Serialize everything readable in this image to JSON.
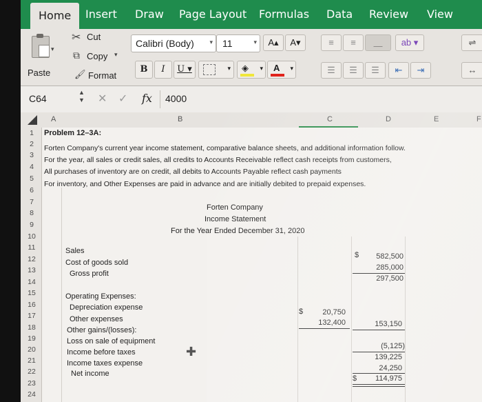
{
  "ribbon_tabs": [
    "Home",
    "Insert",
    "Draw",
    "Page Layout",
    "Formulas",
    "Data",
    "Review",
    "View"
  ],
  "clipboard": {
    "paste": "Paste",
    "cut": "Cut",
    "copy": "Copy",
    "format": "Format"
  },
  "font": {
    "name": "Calibri (Body)",
    "size": "11",
    "grow": "A▴",
    "shrink": "A▾"
  },
  "formula_bar": {
    "cell_ref": "C64",
    "fx": "fx",
    "value": "4000"
  },
  "columns": [
    "A",
    "B",
    "C",
    "D",
    "E",
    "F"
  ],
  "rows": [
    "1",
    "2",
    "3",
    "4",
    "5",
    "6",
    "7",
    "8",
    "9",
    "10",
    "11",
    "12",
    "13",
    "14",
    "15",
    "16",
    "17",
    "18",
    "19",
    "20",
    "21",
    "22",
    "23",
    "24"
  ],
  "sheet": {
    "r1": "Problem 12–3A:",
    "r2": "Forten Company's current year income statement, comparative balance sheets, and additional information follow.",
    "r3": "For the year, all sales or credit sales, all credits to Accounts Receivable reflect cash receipts from customers,",
    "r4": "All purchases of inventory are on credit, all debits to Accounts Payable reflect cash payments",
    "r5": "For inventory, and Other Expenses are paid in advance and are initially debited to prepaid expenses.",
    "company": "Forten Company",
    "statement": "Income Statement",
    "period": "For the Year Ended December 31, 2020",
    "lines": {
      "sales": "Sales",
      "cogs": "Cost of goods sold",
      "gross": "Gross profit",
      "opex": "Operating Expenses:",
      "dep": "Depreciation expense",
      "other": "Other expenses",
      "gains": "Other gains/(losses):",
      "loss": "Loss on sale of equipment",
      "ibt": "Income before taxes",
      "tax": "Income taxes expense",
      "net": "Net income"
    },
    "values": {
      "sales": "582,500",
      "cogs": "285,000",
      "gross": "297,500",
      "dep": "20,750",
      "other": "132,400",
      "opex_total": "153,150",
      "loss": "(5,125)",
      "ibt": "139,225",
      "tax": "24,250",
      "net": "114,975"
    },
    "dollar": "$"
  }
}
